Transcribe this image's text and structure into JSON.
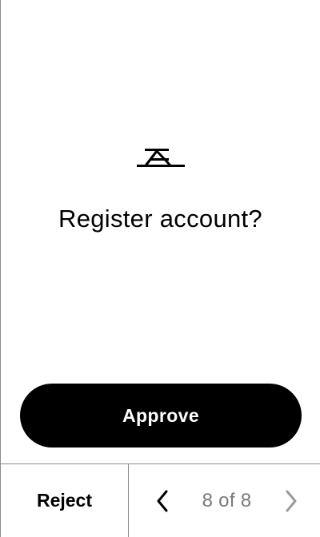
{
  "prompt": {
    "logo_icon": "trezor-style-logo-icon",
    "title": "Register account?"
  },
  "actions": {
    "approve_label": "Approve",
    "reject_label": "Reject"
  },
  "pager": {
    "prev_icon": "chevron-left-icon",
    "next_icon": "chevron-right-icon",
    "indicator": "8 of 8",
    "current_page": 8,
    "total_pages": 8
  },
  "colors": {
    "primary": "#000000",
    "background": "#ffffff",
    "muted_text": "#7a7a7a",
    "divider": "#8c8c8c"
  }
}
